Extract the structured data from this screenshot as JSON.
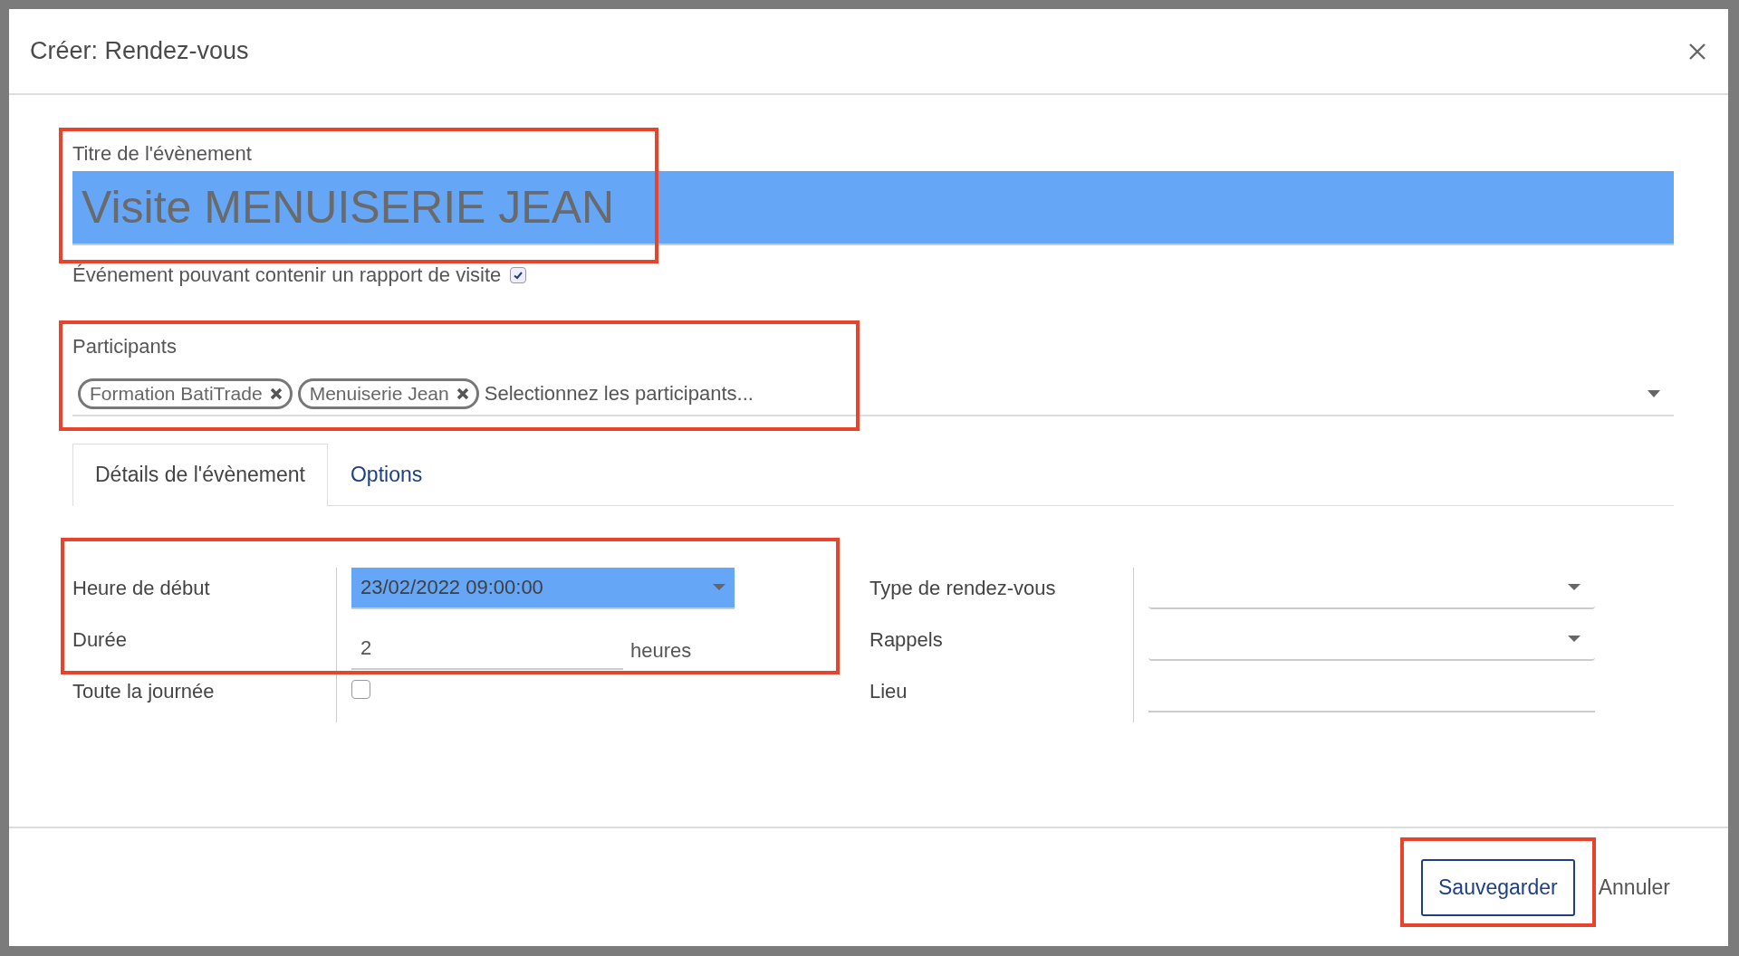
{
  "dialog": {
    "title": "Créer: Rendez-vous"
  },
  "title_field": {
    "label": "Titre de l'évènement",
    "value": "Visite MENUISERIE JEAN",
    "selected": true
  },
  "report_option": {
    "label": "Événement pouvant contenir un rapport de visite",
    "checked": true
  },
  "participants": {
    "label": "Participants",
    "placeholder": "Selectionnez les participants...",
    "tags": [
      {
        "label": "Formation BatiTrade"
      },
      {
        "label": "Menuiserie Jean"
      }
    ]
  },
  "tabs": [
    {
      "label": "Détails de l'évènement",
      "selected": true
    },
    {
      "label": "Options",
      "selected": false
    }
  ],
  "left_fields": [
    {
      "kind": "datetime",
      "label": "Heure de début",
      "value": "23/02/2022 09:00:00",
      "selected": true
    },
    {
      "kind": "duration",
      "label": "Durée",
      "value": "2",
      "unit": "heures"
    },
    {
      "kind": "checkbox",
      "label": "Toute la journée",
      "checked": false
    }
  ],
  "right_fields": [
    {
      "kind": "select",
      "label": "Type de rendez-vous"
    },
    {
      "kind": "select",
      "label": "Rappels"
    },
    {
      "kind": "text",
      "label": "Lieu"
    }
  ],
  "buttons": [
    {
      "kind": "primary",
      "label": "Sauvegarder"
    },
    {
      "kind": "link",
      "label": "Annuler"
    }
  ]
}
